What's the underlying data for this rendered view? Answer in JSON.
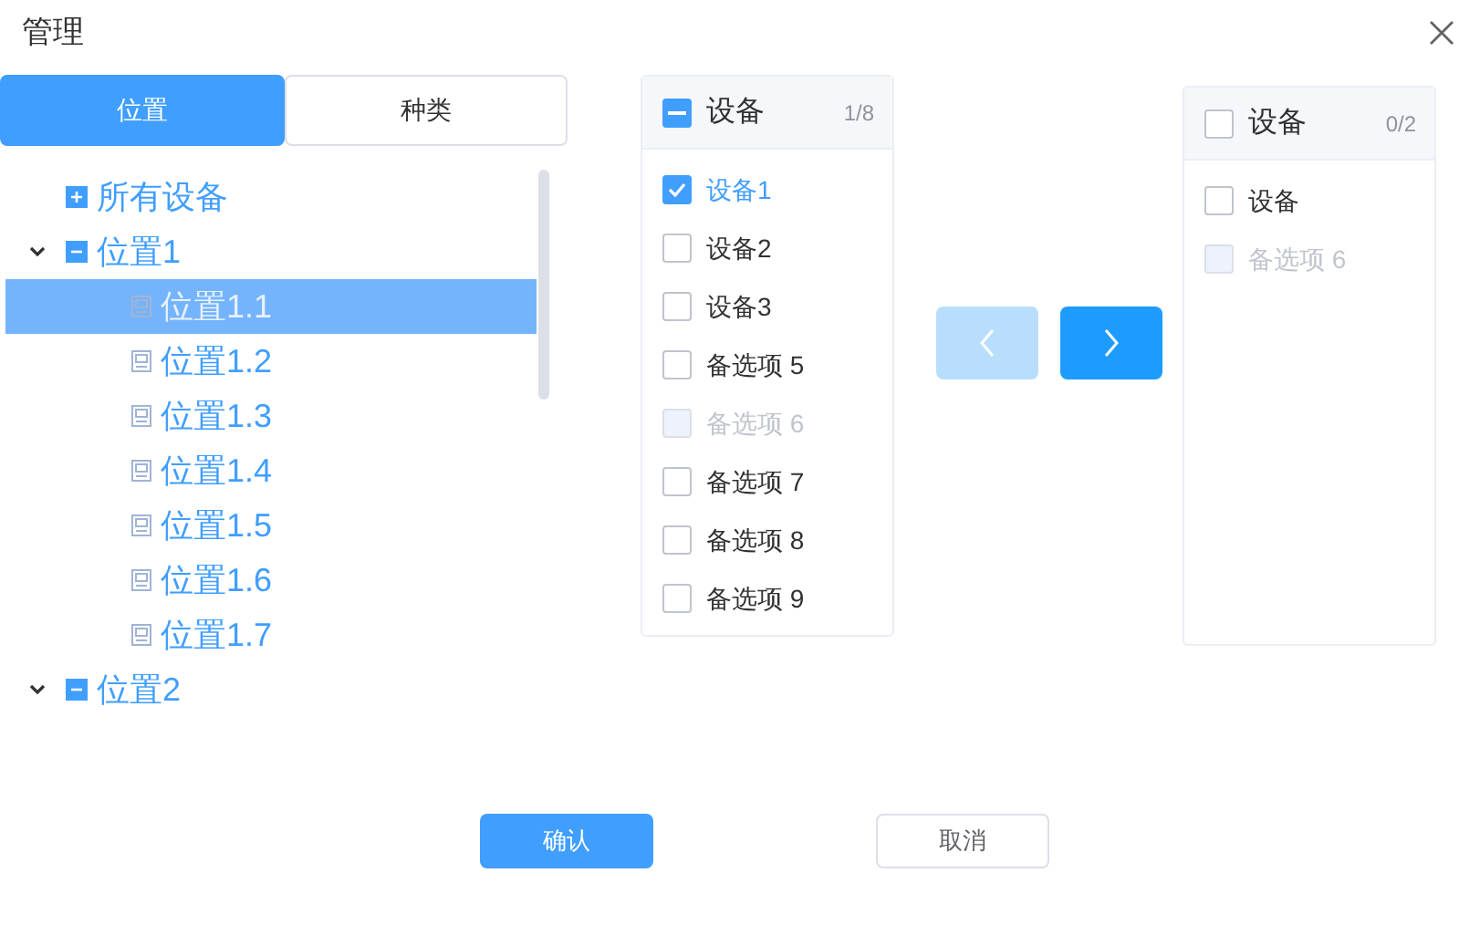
{
  "dialog": {
    "title": "管理"
  },
  "tabs": [
    {
      "label": "位置",
      "selected": true
    },
    {
      "label": "种类",
      "selected": false
    }
  ],
  "tree": [
    {
      "label": "所有设备",
      "kind": "group",
      "expanded": false,
      "selected": false
    },
    {
      "label": "位置1",
      "kind": "group",
      "expanded": true,
      "selected": false,
      "children": [
        {
          "label": "位置1.1",
          "kind": "leaf",
          "selected": true
        },
        {
          "label": "位置1.2",
          "kind": "leaf",
          "selected": false
        },
        {
          "label": "位置1.3",
          "kind": "leaf",
          "selected": false
        },
        {
          "label": "位置1.4",
          "kind": "leaf",
          "selected": false
        },
        {
          "label": "位置1.5",
          "kind": "leaf",
          "selected": false
        },
        {
          "label": "位置1.6",
          "kind": "leaf",
          "selected": false
        },
        {
          "label": "位置1.7",
          "kind": "leaf",
          "selected": false
        }
      ]
    },
    {
      "label": "位置2",
      "kind": "group",
      "expanded": true,
      "selected": false
    }
  ],
  "transfer": {
    "source": {
      "title": "设备",
      "count": "1/8",
      "indeterminate": true,
      "items": [
        {
          "label": "设备1",
          "checked": true,
          "disabled": false
        },
        {
          "label": "设备2",
          "checked": false,
          "disabled": false
        },
        {
          "label": "设备3",
          "checked": false,
          "disabled": false
        },
        {
          "label": "备选项 5",
          "checked": false,
          "disabled": false
        },
        {
          "label": "备选项 6",
          "checked": false,
          "disabled": true
        },
        {
          "label": "备选项 7",
          "checked": false,
          "disabled": false
        },
        {
          "label": "备选项 8",
          "checked": false,
          "disabled": false
        },
        {
          "label": "备选项 9",
          "checked": false,
          "disabled": false
        }
      ]
    },
    "move_left": {
      "disabled": true
    },
    "move_right": {
      "disabled": false
    },
    "target": {
      "title": "设备",
      "count": "0/2",
      "checked": false,
      "indeterminate": false,
      "items": [
        {
          "label": "设备",
          "checked": false,
          "disabled": false
        },
        {
          "label": "备选项 6",
          "checked": false,
          "disabled": true
        }
      ]
    }
  },
  "buttons": [
    {
      "label": "确认",
      "kind": "primary"
    },
    {
      "label": "取消",
      "kind": "default"
    }
  ]
}
